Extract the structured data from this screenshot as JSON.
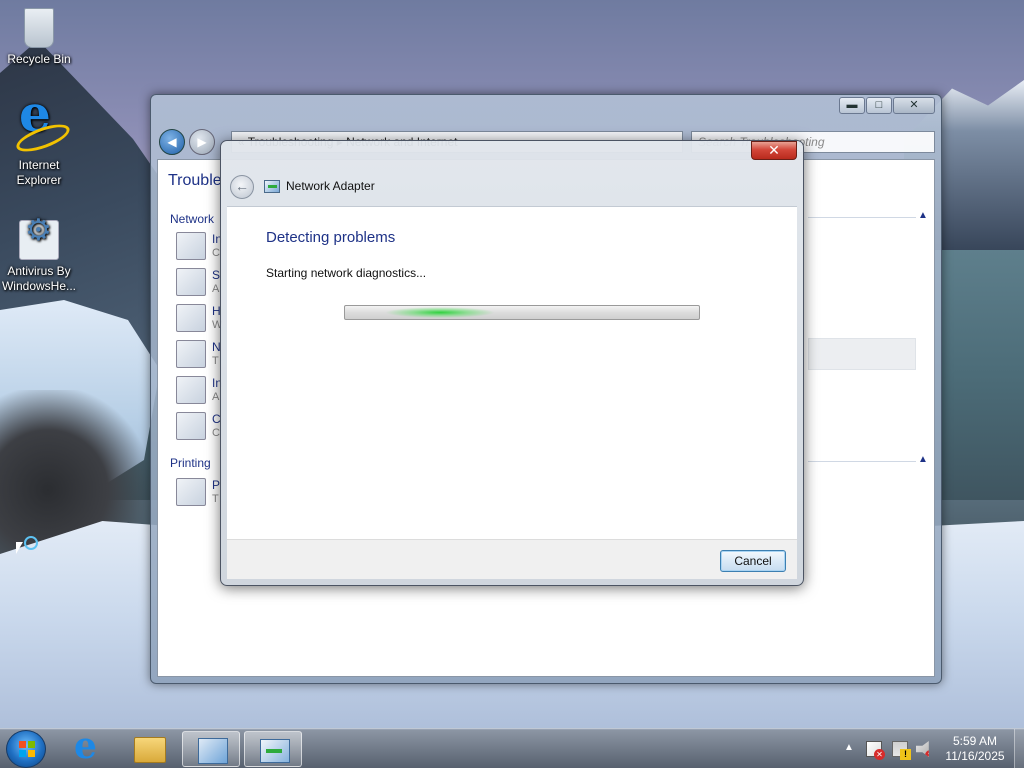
{
  "desktop": {
    "icons": [
      {
        "label": "Recycle Bin",
        "icon": "recycle-bin-icon"
      },
      {
        "label": "Internet Explorer",
        "icon": "internet-explorer-icon"
      },
      {
        "label": "Antivirus By WindowsHe...",
        "icon": "antivirus-icon"
      }
    ]
  },
  "explorer": {
    "address": "« Troubleshooting ▸ Network and Internet",
    "search_placeholder": "Search Troubleshooting",
    "title": "Trouble",
    "sections": [
      {
        "label": "Network"
      },
      {
        "label": "Printing"
      }
    ],
    "items": [
      {
        "t1": "In",
        "t2": "C"
      },
      {
        "t1": "S",
        "t2": "A"
      },
      {
        "t1": "H",
        "t2": "W"
      },
      {
        "t1": "N",
        "t2": "T"
      },
      {
        "t1": "In",
        "t2": "A"
      },
      {
        "t1": "C",
        "t2": "C"
      },
      {
        "t1": "P",
        "t2": "T"
      }
    ],
    "controls": {
      "minimize": "▬",
      "maximize": "□",
      "close": "✕"
    }
  },
  "dialog": {
    "close_label": "✕",
    "heading": "Network Adapter",
    "title": "Detecting problems",
    "status": "Starting network diagnostics...",
    "progress": {
      "mode": "indeterminate",
      "glow_color": "#2fd13f"
    },
    "cancel_label": "Cancel",
    "back_label": "←"
  },
  "taskbar": {
    "tray_arrow": "▲",
    "time": "5:59 AM",
    "date": "11/16/2025",
    "buttons": [
      {
        "name": "start"
      },
      {
        "name": "internet-explorer"
      },
      {
        "name": "file-explorer"
      },
      {
        "name": "control-panel",
        "active": true
      },
      {
        "name": "network-adapter",
        "active": true
      }
    ]
  },
  "colors": {
    "link_blue": "#1e3287",
    "close_red": "#c9372c",
    "button_border": "#3c7fb1"
  }
}
